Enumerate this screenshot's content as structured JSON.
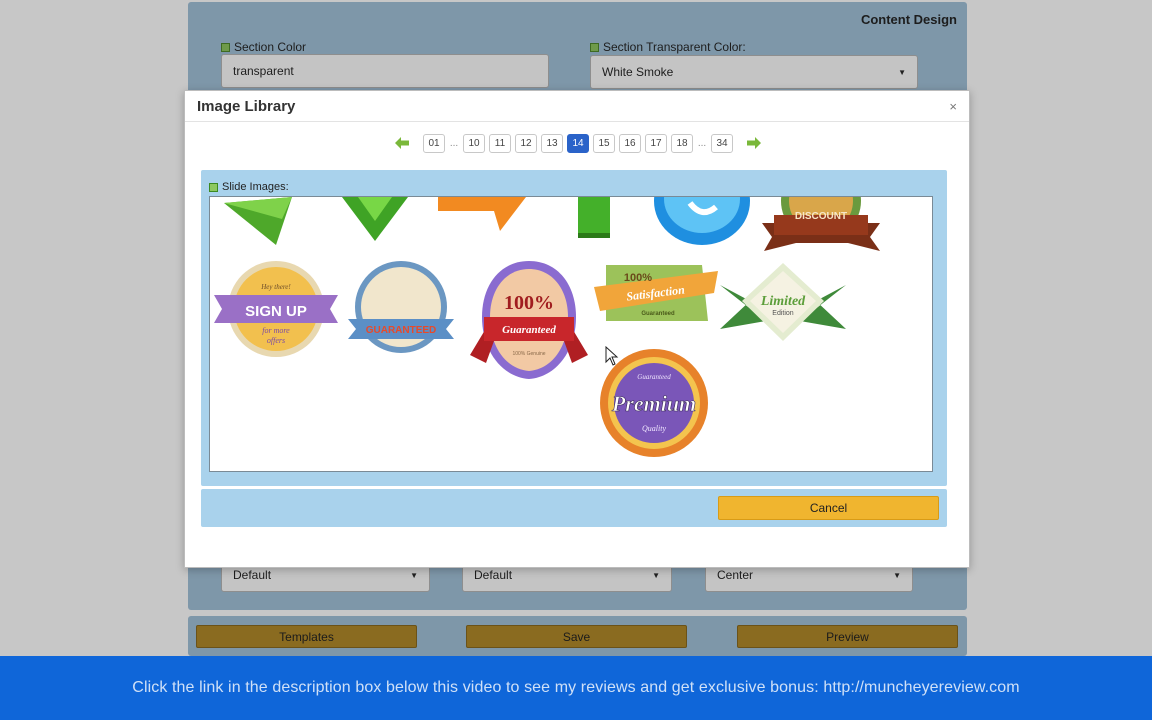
{
  "background": {
    "page_title": "Content Design",
    "section_color_label": "Section Color",
    "section_color_value": "transparent",
    "section_transparent_color_label": "Section Transparent Color:",
    "section_transparent_color_value": "White Smoke",
    "select1_value": "Default",
    "select2_value": "Default",
    "select3_value": "Center",
    "buttons": {
      "templates": "Templates",
      "save": "Save",
      "preview": "Preview"
    }
  },
  "modal": {
    "title": "Image Library",
    "close_label": "×",
    "pagination": {
      "pages": [
        "01",
        "10",
        "11",
        "12",
        "13",
        "14",
        "15",
        "16",
        "17",
        "18",
        "34"
      ],
      "current": "14",
      "ellipsis": "..."
    },
    "slide_images_label": "Slide Images:",
    "badges": [
      {
        "name": "green-arrow-badge"
      },
      {
        "name": "green-down-arrow-badge"
      },
      {
        "name": "orange-arrow-badge"
      },
      {
        "name": "green-arrow-up-badge"
      },
      {
        "name": "skype-badge"
      },
      {
        "name": "discount-badge",
        "text": "DISCOUNT"
      },
      {
        "name": "sign-up-badge",
        "line1": "Hey there!",
        "text": "SIGN UP",
        "line2": "for more",
        "line3": "offers"
      },
      {
        "name": "guaranteed-seal-badge",
        "text": "GUARANTEED"
      },
      {
        "name": "guaranteed-100-badge",
        "pct": "100%",
        "text": "Guaranteed",
        "sub": "100% Genuine"
      },
      {
        "name": "satisfaction-badge",
        "pct": "100%",
        "text": "Satisfaction",
        "sub": "Guaranteed"
      },
      {
        "name": "limited-edition-badge",
        "text": "Limited",
        "sub": "Edition"
      },
      {
        "name": "premium-badge",
        "top": "Guaranteed",
        "text": "Premium",
        "sub": "Quality"
      }
    ],
    "cancel_label": "Cancel"
  },
  "promo": {
    "text": "Click the link in the description box below this video to see my reviews and get exclusive bonus:  http://muncheyereview.com"
  },
  "colors": {
    "accent_blue": "#2a63c9",
    "cancel_orange": "#f0b52f",
    "panel_blue": "#a9d2ec",
    "promo_blue": "#0f66d9"
  }
}
